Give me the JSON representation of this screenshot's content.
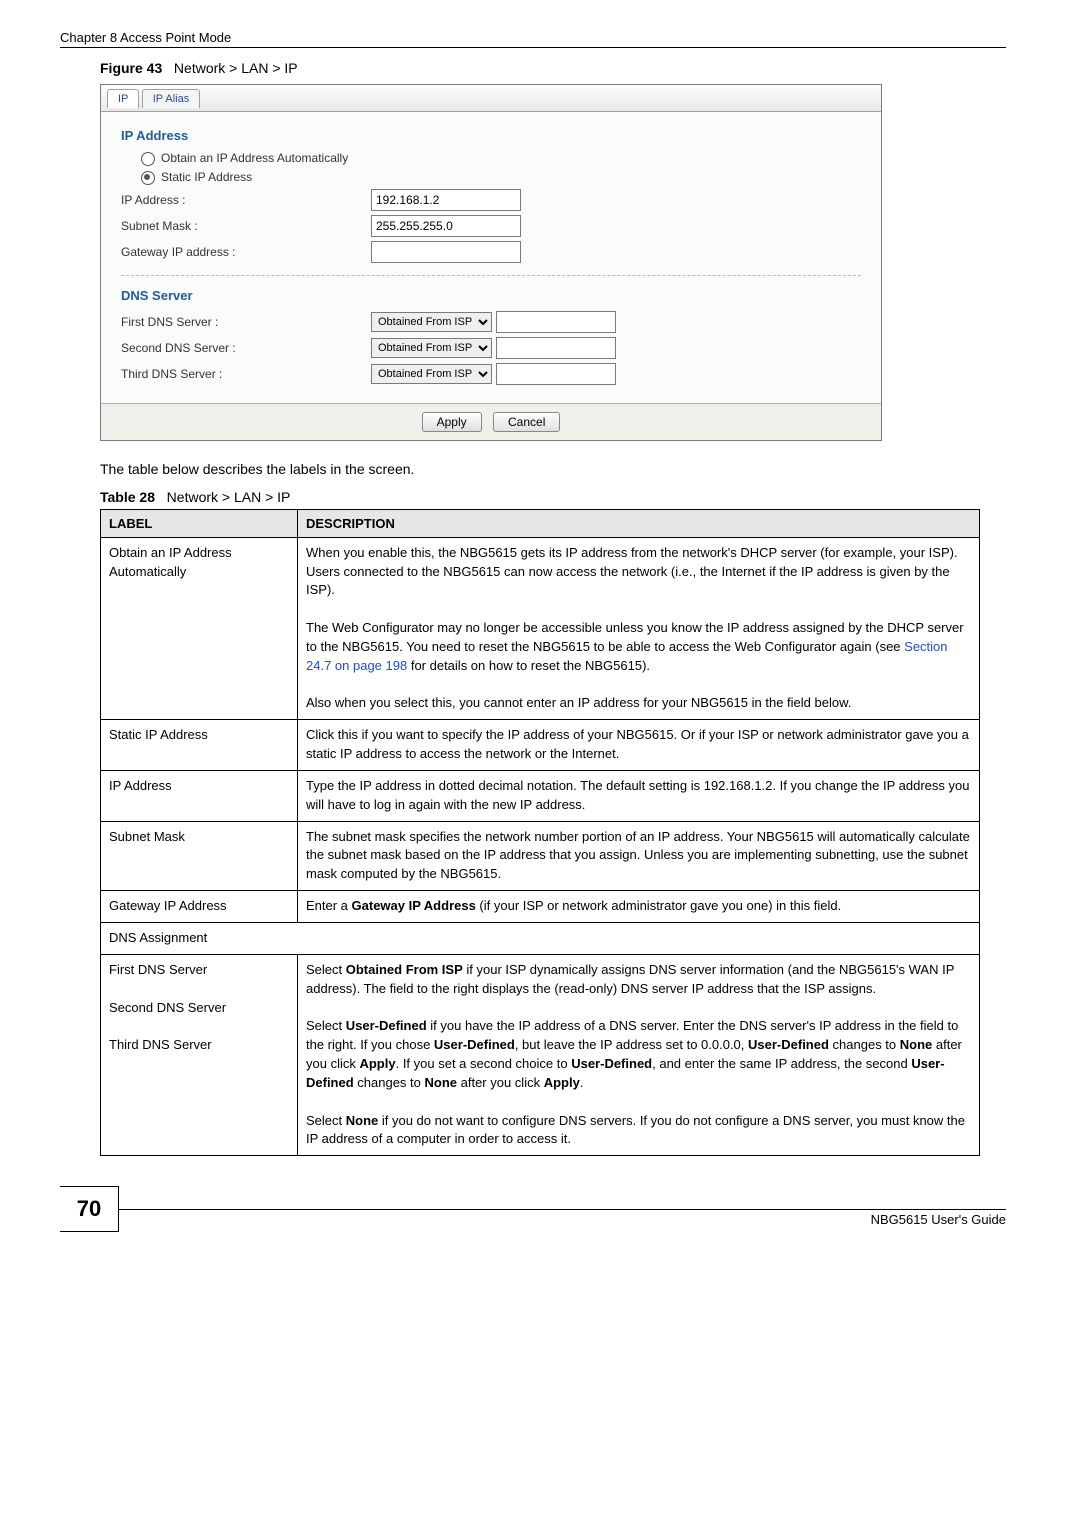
{
  "chapter_header": "Chapter 8 Access Point Mode",
  "figure_label": "Figure 43",
  "figure_title": "Network > LAN > IP",
  "screenshot": {
    "tab_ip": "IP",
    "tab_ip_alias": "IP Alias",
    "section_ip_address": "IP Address",
    "opt_obtain_auto": "Obtain an IP Address Automatically",
    "opt_static": "Static IP Address",
    "lbl_ip_address": "IP Address :",
    "val_ip_address": "192.168.1.2",
    "lbl_subnet_mask": "Subnet Mask :",
    "val_subnet_mask": "255.255.255.0",
    "lbl_gateway": "Gateway IP address :",
    "val_gateway": "",
    "section_dns": "DNS Server",
    "lbl_dns1": "First DNS Server :",
    "lbl_dns2": "Second DNS Server :",
    "lbl_dns3": "Third DNS Server :",
    "dns_select": "Obtained From ISP",
    "btn_apply": "Apply",
    "btn_cancel": "Cancel"
  },
  "intro_text": "The table below describes the labels in the screen.",
  "table_label": "Table 28",
  "table_title": "Network > LAN > IP",
  "table_header_label": "LABEL",
  "table_header_desc": "DESCRIPTION",
  "rows": {
    "r1_label": "Obtain an IP Address Automatically",
    "r1_desc_p1": "When you enable this, the NBG5615 gets its IP address from the network's DHCP server (for example, your ISP). Users connected to the NBG5615 can now access the network (i.e., the Internet if the IP address is given by the ISP).",
    "r1_desc_p2a": "The Web Configurator may no longer be accessible unless you know the IP address assigned by the DHCP server to the NBG5615. You need to reset the NBG5615 to be able to access the Web Configurator again (see ",
    "r1_desc_link": "Section 24.7 on page 198",
    "r1_desc_p2b": " for details on how to reset the NBG5615).",
    "r1_desc_p3": "Also when you select this, you cannot enter an IP address for your NBG5615 in the field below.",
    "r2_label": "Static IP Address",
    "r2_desc": "Click this if you want to specify the IP address of your NBG5615. Or if your ISP or network administrator gave you a static IP address to access the network or the Internet.",
    "r3_label": "IP Address",
    "r3_desc": "Type the IP address in dotted decimal notation. The default setting is 192.168.1.2. If you change the IP address you will have to log in again with the new IP address.",
    "r4_label": "Subnet Mask",
    "r4_desc": "The subnet mask specifies the network number portion of an IP address. Your NBG5615 will automatically calculate the subnet mask based on the IP address that you assign. Unless you are implementing subnetting, use the subnet mask computed by the NBG5615.",
    "r5_label": "Gateway IP Address",
    "r5_desc_a": "Enter a ",
    "r5_desc_bold": "Gateway IP Address",
    "r5_desc_b": " (if your ISP or network administrator gave you one) in this field.",
    "r6_label": "DNS Assignment",
    "r7_label_1": "First DNS Server",
    "r7_label_2": "Second DNS Server",
    "r7_label_3": "Third DNS Server",
    "r7_p1a": "Select ",
    "r7_p1_bold": "Obtained From ISP",
    "r7_p1b": " if your ISP dynamically assigns DNS server information (and the NBG5615's WAN IP address). The field to the right displays the (read-only) DNS server IP address that the ISP assigns.",
    "r7_p2a": "Select ",
    "r7_p2_b1": "User-Defined",
    "r7_p2b": " if you have the IP address of a DNS server. Enter the DNS server's IP address in the field to the right. If you chose ",
    "r7_p2_b2": "User-Defined",
    "r7_p2c": ", but leave the IP address set to 0.0.0.0, ",
    "r7_p2_b3": "User-Defined",
    "r7_p2d": " changes to ",
    "r7_p2_b4": "None",
    "r7_p2e": " after you click ",
    "r7_p2_b5": "Apply",
    "r7_p2f": ". If you set a second choice to ",
    "r7_p2_b6": "User-Defined",
    "r7_p2g": ", and enter the same IP address, the second ",
    "r7_p2_b7": "User-Defined",
    "r7_p2h": " changes to ",
    "r7_p2_b8": "None",
    "r7_p2i": " after you click ",
    "r7_p2_b9": "Apply",
    "r7_p2j": ".",
    "r7_p3a": "Select ",
    "r7_p3_b1": "None",
    "r7_p3b": " if you do not want to configure DNS servers. If you do not configure a DNS server, you must know the IP address of a computer in order to access it."
  },
  "page_number": "70",
  "guide_title": "NBG5615 User's Guide"
}
